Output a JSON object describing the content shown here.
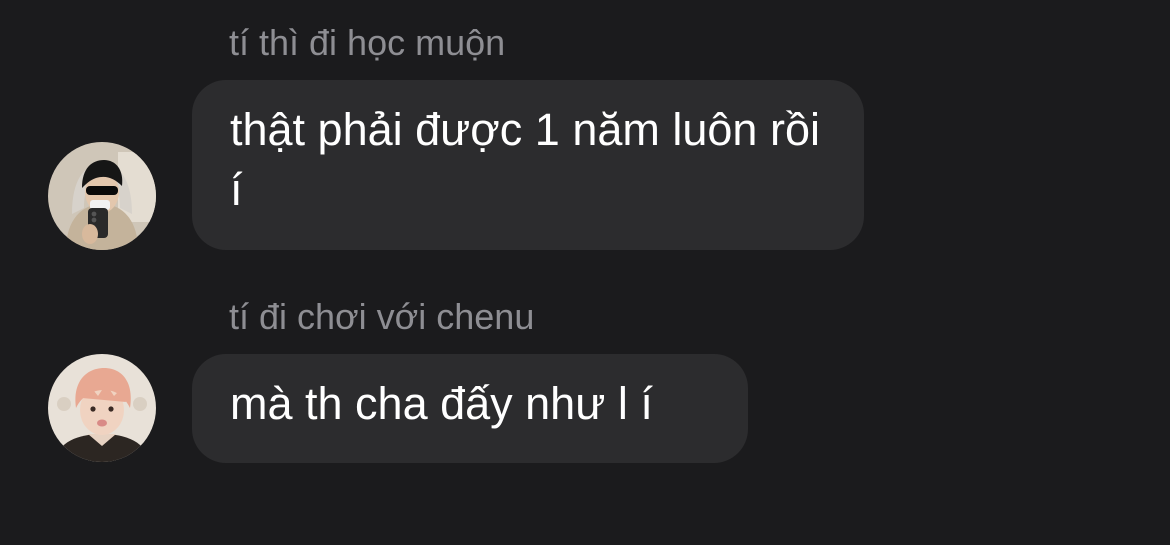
{
  "messages": [
    {
      "sender": "tí thì đi học muộn",
      "text": "thật phải được 1 năm luôn rồi í",
      "avatar_icon": "user-avatar-sunglasses-icon"
    },
    {
      "sender": "tí đi chơi với chenu",
      "text": "mà th cha đấy như l í",
      "avatar_icon": "user-avatar-pink-hair-icon"
    }
  ],
  "colors": {
    "background": "#1b1b1d",
    "bubble": "#2c2c2e",
    "sender_text": "#8e8e93",
    "message_text": "#ffffff"
  }
}
